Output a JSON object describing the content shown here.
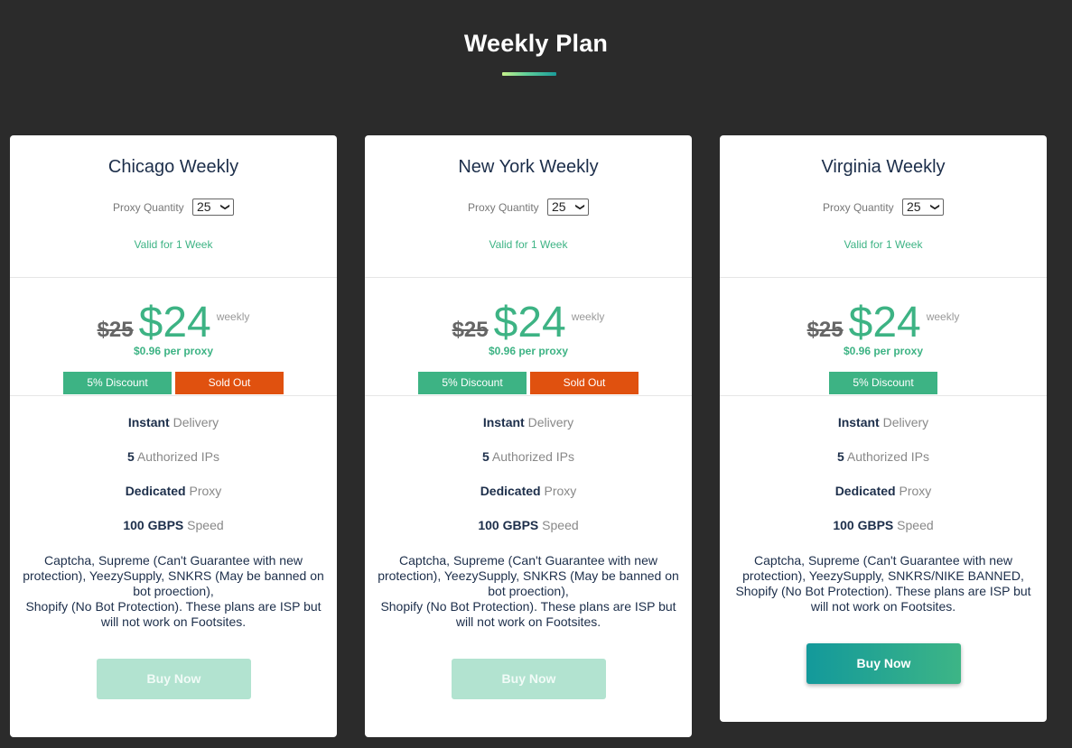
{
  "page": {
    "title": "Weekly Plan"
  },
  "plans": [
    {
      "title": "Chicago Weekly",
      "quantity_label": "Proxy Quantity",
      "quantity_value": "25",
      "validity": "Valid for 1 Week",
      "old_price": "$25",
      "price": "$24",
      "period": "weekly",
      "per_proxy": "$0.96 per proxy",
      "discount_badge": "5% Discount",
      "status_badge": "Sold Out",
      "features": [
        {
          "strong": "Instant",
          "rest": " Delivery"
        },
        {
          "strong": "5",
          "rest": " Authorized IPs"
        },
        {
          "strong": "Dedicated",
          "rest": " Proxy"
        },
        {
          "strong": "100 GBPS",
          "rest": " Speed"
        }
      ],
      "note_lines": [
        "Captcha, Supreme (Can't Guarantee with new protection), YeezySupply, SNKRS (May be banned on bot proection),",
        "Shopify (No Bot Protection). These plans are ISP but will not work on Footsites."
      ],
      "buy_label": "Buy Now",
      "buy_enabled": false
    },
    {
      "title": "New York Weekly",
      "quantity_label": "Proxy Quantity",
      "quantity_value": "25",
      "validity": "Valid for 1 Week",
      "old_price": "$25",
      "price": "$24",
      "period": "weekly",
      "per_proxy": "$0.96 per proxy",
      "discount_badge": "5% Discount",
      "status_badge": "Sold Out",
      "features": [
        {
          "strong": "Instant",
          "rest": " Delivery"
        },
        {
          "strong": "5",
          "rest": " Authorized IPs"
        },
        {
          "strong": "Dedicated",
          "rest": " Proxy"
        },
        {
          "strong": "100 GBPS",
          "rest": " Speed"
        }
      ],
      "note_lines": [
        "Captcha, Supreme (Can't Guarantee with new protection), YeezySupply, SNKRS (May be banned on bot proection),",
        "Shopify (No Bot Protection). These plans are ISP but will not work on Footsites."
      ],
      "buy_label": "Buy Now",
      "buy_enabled": false
    },
    {
      "title": "Virginia Weekly",
      "quantity_label": "Proxy Quantity",
      "quantity_value": "25",
      "validity": "Valid for 1 Week",
      "old_price": "$25",
      "price": "$24",
      "period": "weekly",
      "per_proxy": "$0.96 per proxy",
      "discount_badge": "5% Discount",
      "features": [
        {
          "strong": "Instant",
          "rest": " Delivery"
        },
        {
          "strong": "5",
          "rest": " Authorized IPs"
        },
        {
          "strong": "Dedicated",
          "rest": " Proxy"
        },
        {
          "strong": "100 GBPS",
          "rest": " Speed"
        }
      ],
      "note_lines": [
        "Captcha, Supreme (Can't Guarantee with new protection), YeezySupply, SNKRS/NIKE BANNED, Shopify (No Bot Protection). These plans are ISP but will not work on Footsites."
      ],
      "buy_label": "Buy Now",
      "buy_enabled": true
    }
  ],
  "colors": {
    "accent": "#3db384",
    "sold_out": "#e0510f",
    "background": "#2b2b2b",
    "heading": "#1c2e4a"
  }
}
